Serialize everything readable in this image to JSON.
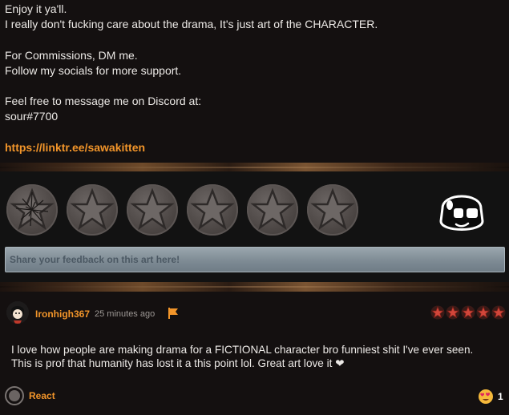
{
  "description": {
    "lines": [
      "Enjoy it ya'll.",
      "I really don't fucking care about the drama, It's just art of the CHARACTER.",
      "",
      "For Commissions, DM me.",
      "Follow my socials for more support.",
      "",
      "Feel free to message me on Discord at:",
      "sour#7700",
      ""
    ],
    "link": "https://linktr.ee/sawakitten"
  },
  "rating": {
    "star_count": 6,
    "star_icon": "star-circle-icon",
    "mascot_icon": "mascot-face-icon",
    "feedback_placeholder": "Share your feedback on this art here!"
  },
  "comment": {
    "username": "Ironhigh367",
    "timestamp": "25 minutes ago",
    "flag_icon": "flag-icon",
    "rating_stars": 5,
    "text_lines": [
      "I love how people are making drama for a FICTIONAL character bro funniest shit I've ever seen.",
      "This is prof that humanity has lost it a this point lol. Great art love it ❤"
    ],
    "react_label": "React",
    "reaction_emoji": "heart-eyes-emoji-icon",
    "reaction_count": "1"
  },
  "colors": {
    "background": "#141010",
    "accent": "#f2952a",
    "star_fill": "#4d4745",
    "mini_star": "#d2463a"
  }
}
